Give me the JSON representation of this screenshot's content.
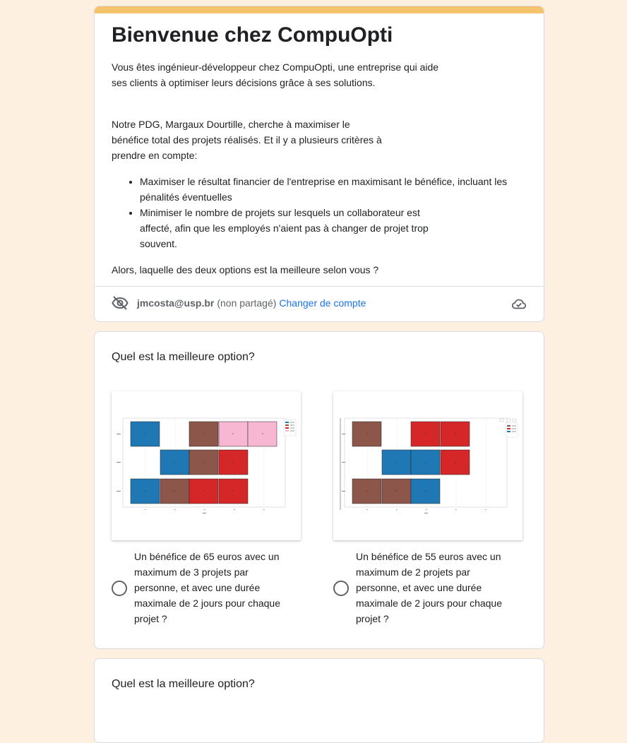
{
  "form": {
    "title": "Bienvenue chez CompuOpti",
    "intro": [
      "Vous êtes ingénieur-développeur chez CompuOpti, une entreprise qui aide",
      "ses clients à optimiser leurs décisions grâce à ses solutions."
    ],
    "context": [
      "Notre PDG, Margaux Dourtille, cherche à maximiser le",
      "bénéfice total des projets réalisés. Et il y a plusieurs critères à",
      "prendre en compte:"
    ],
    "criteria": [
      "Maximiser le résultat financier de l'entreprise en maximisant le bénéfice, incluant les pénalités éventuelles",
      "Minimiser le nombre de projets sur lesquels un collaborateur est affecté, afin que les employés n'aient pas à changer de projet trop souvent."
    ],
    "question_intro": "Alors, laquelle des deux options est la meilleure selon vous ?"
  },
  "account": {
    "email": "jmcosta@usp.br",
    "visibility": "(non partagé)",
    "switch_label": "Changer de compte",
    "privacy_icon": "eye-off-icon",
    "save_icon": "cloud-saved-icon"
  },
  "questions": [
    {
      "title": "Quel est la meilleure option?",
      "options": [
        {
          "label": "Un bénéfice de 65 euros avec un maximum de 3 projets par personne, et avec une durée maximale de 2 jours pour chaque projet ?"
        },
        {
          "label": "Un bénéfice de 55 euros avec un maximum de 2 projets par personne, et avec une durée maximale de 2 jours pour chaque projet ?"
        }
      ]
    },
    {
      "title": "Quel est la meilleure option?"
    }
  ],
  "colors": {
    "accent": "#f4c36b",
    "link": "#1a73e8",
    "blue": "#1f77b4",
    "brown": "#8c564b",
    "red": "#d62728",
    "pink": "#f7b6d2"
  }
}
